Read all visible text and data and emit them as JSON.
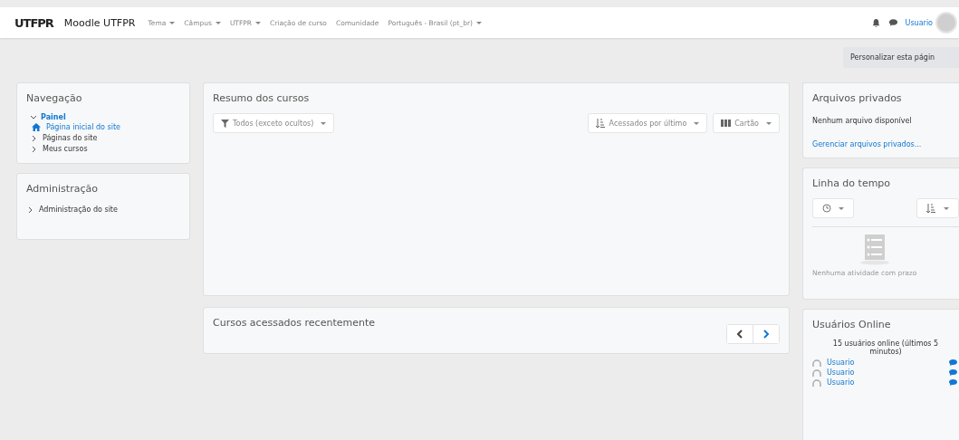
{
  "navbar": {
    "logo": "UTFPR",
    "site_name": "Moodle UTFPR",
    "menu": [
      {
        "label": "Tema",
        "dropdown": true
      },
      {
        "label": "Câmpus",
        "dropdown": true
      },
      {
        "label": "UTFPR",
        "dropdown": true
      },
      {
        "label": "Criação de curso",
        "dropdown": false
      },
      {
        "label": "Comunidade",
        "dropdown": false
      },
      {
        "label": "Português - Brasil (pt_br)",
        "dropdown": true
      }
    ],
    "user": "Usuario"
  },
  "customize_button": "Personalizar esta págin",
  "navigation": {
    "title": "Navegação",
    "root": {
      "label": "Painel",
      "expanded": true,
      "children": [
        {
          "label": "Página inicial do site",
          "kind": "home"
        },
        {
          "label": "Páginas do site",
          "kind": "branch"
        },
        {
          "label": "Meus cursos",
          "kind": "branch"
        }
      ]
    }
  },
  "administration": {
    "title": "Administração",
    "items": [
      {
        "label": "Administração do site",
        "kind": "branch"
      }
    ]
  },
  "course_overview": {
    "title": "Resumo dos cursos",
    "filter": "Todos (exceto ocultos)",
    "sort": "Acessados por último",
    "view": "Cartão"
  },
  "recent_courses": {
    "title": "Cursos acessados recentemente"
  },
  "private_files": {
    "title": "Arquivos privados",
    "message": "Nenhum arquivo disponível",
    "link": "Gerenciar arquivos privados..."
  },
  "timeline": {
    "title": "Linha do tempo",
    "empty": "Nenhuma atividade com prazo"
  },
  "online_users": {
    "title": "Usuários Online",
    "summary": "15 usuários online (últimos 5 minutos)",
    "users": [
      "Usuario",
      "Usuario",
      "Usuario"
    ]
  }
}
